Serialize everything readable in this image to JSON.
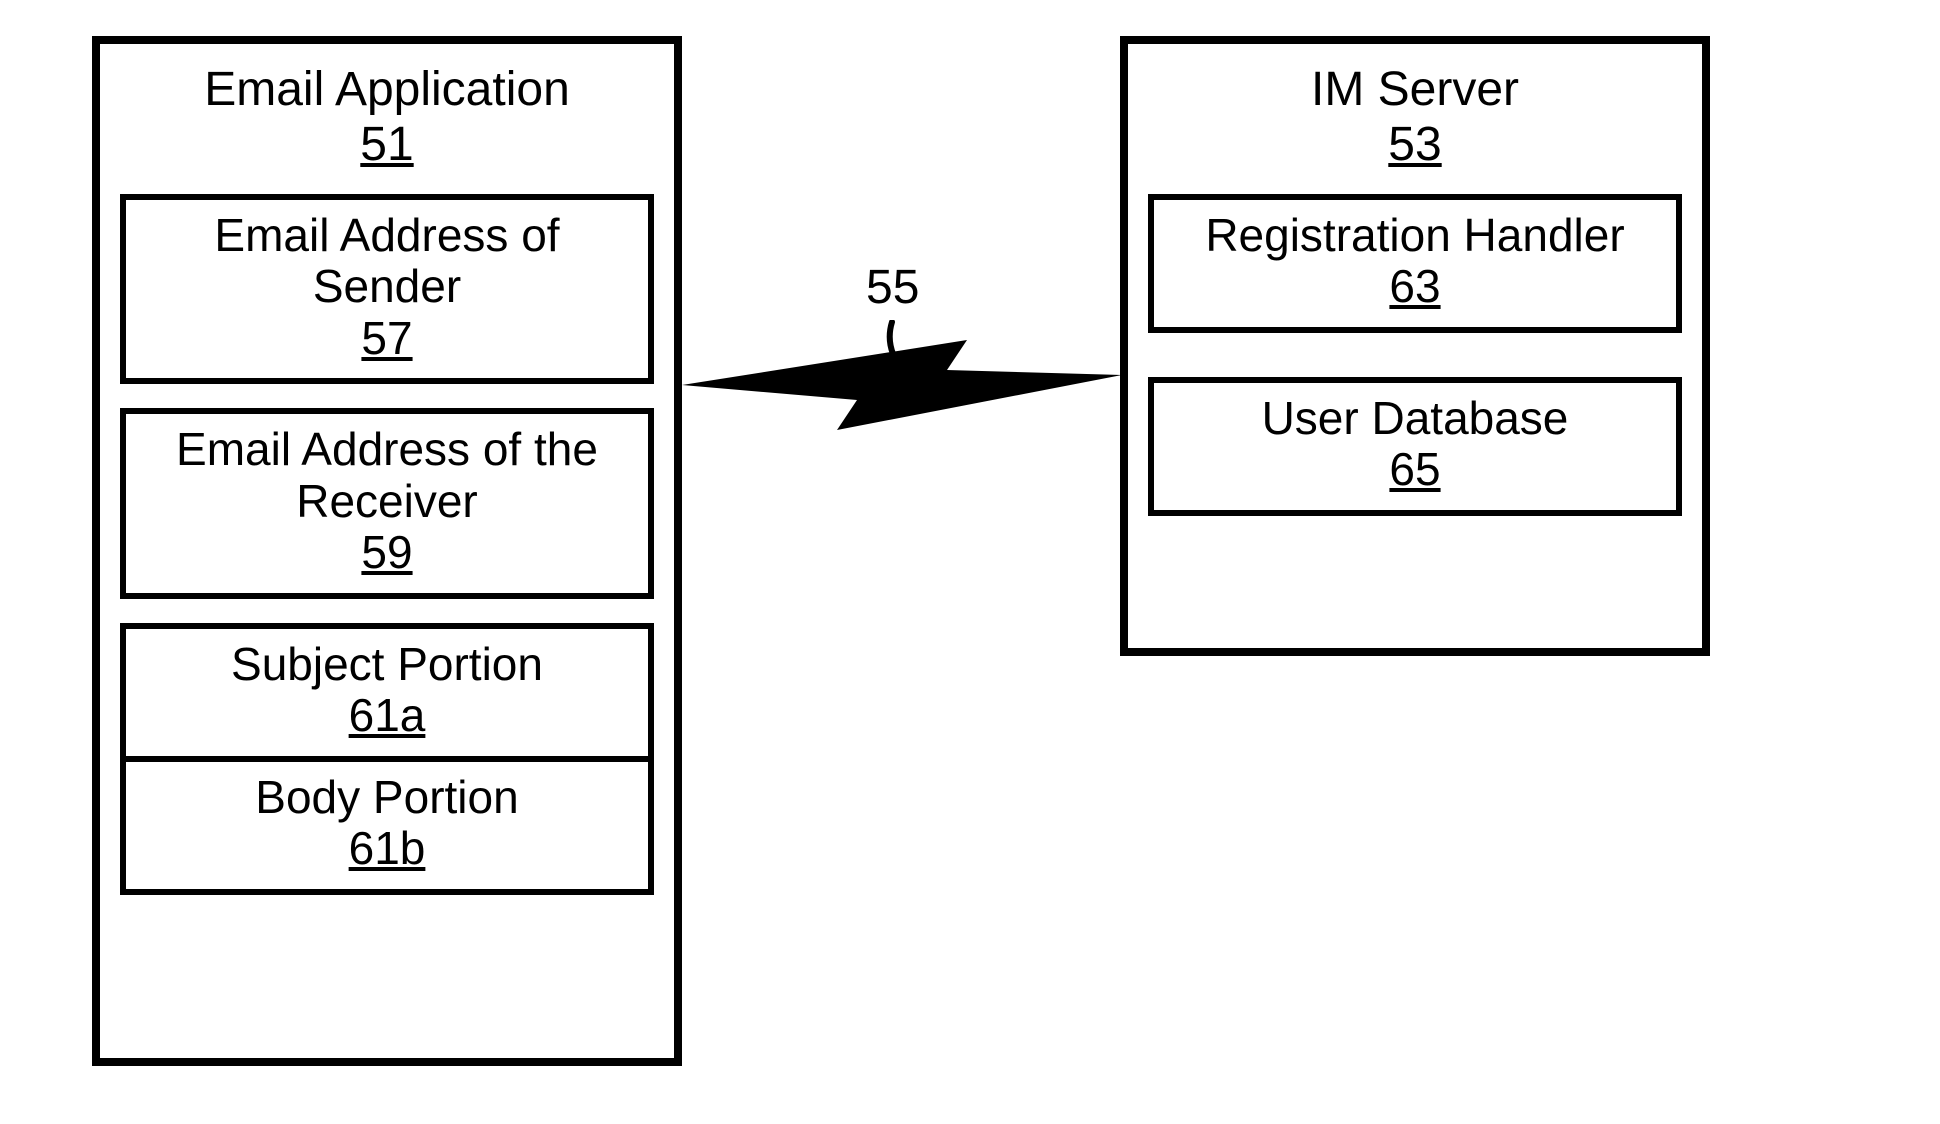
{
  "left": {
    "title": "Email Application",
    "ref": "51",
    "items": [
      {
        "title": "Email Address of Sender",
        "ref": "57"
      },
      {
        "title": "Email Address of the Receiver",
        "ref": "59"
      },
      {
        "title": "Subject Portion",
        "ref": "61a"
      },
      {
        "title": "Body Portion",
        "ref": "61b"
      }
    ]
  },
  "right": {
    "title": "IM Server",
    "ref": "53",
    "items": [
      {
        "title": "Registration Handler",
        "ref": "63"
      },
      {
        "title": "User Database",
        "ref": "65"
      }
    ]
  },
  "connection": {
    "label": "55"
  }
}
